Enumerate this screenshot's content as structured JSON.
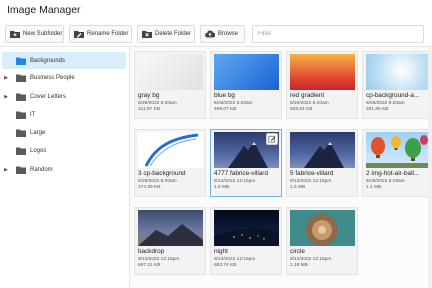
{
  "app": {
    "title": "Image Manager"
  },
  "toolbar": {
    "new_subfolder": "New Subfolder",
    "rename_folder": "Rename Folder",
    "delete_folder": "Delete Folder",
    "browse": "Browse",
    "filter_placeholder": "Filter"
  },
  "sidebar": {
    "items": [
      {
        "label": "Backgrounds",
        "expandable": false,
        "selected": true
      },
      {
        "label": "Business People",
        "expandable": true,
        "selected": false
      },
      {
        "label": "Cover Letters",
        "expandable": true,
        "selected": false
      },
      {
        "label": "IT",
        "expandable": false,
        "selected": false
      },
      {
        "label": "Large",
        "expandable": false,
        "selected": false
      },
      {
        "label": "Logos",
        "expandable": false,
        "selected": false
      },
      {
        "label": "Random",
        "expandable": true,
        "selected": false
      }
    ]
  },
  "images": [
    {
      "name": "gray bg",
      "date": "6/29/2022 8:20am",
      "size": "211.87 KB"
    },
    {
      "name": "blue bg",
      "date": "6/29/2022 8:20am",
      "size": "499.07 KB"
    },
    {
      "name": "red gradient",
      "date": "6/29/2022 8:20am",
      "size": "508.54 KB"
    },
    {
      "name": "cp-background-a...",
      "date": "6/29/2022 8:20am",
      "size": "281.85 KB"
    },
    {
      "name": "3 cp-background",
      "date": "6/29/2022 8:20am",
      "size": "174.39 KB"
    },
    {
      "name": "4777 fabrice-villard",
      "date": "9/13/2022 12:15pm",
      "size": "1.5 MB"
    },
    {
      "name": "5 fabrice-villard",
      "date": "9/13/2022 12:15pm",
      "size": "1.5 MB"
    },
    {
      "name": "2 img-hot-air-ball...",
      "date": "6/29/2022 8:19am",
      "size": "1.1 MB"
    },
    {
      "name": "backdrop",
      "date": "9/13/2022 12:15pm",
      "size": "697.21 KB"
    },
    {
      "name": "night",
      "date": "9/13/2022 12:15pm",
      "size": "883.74 KB"
    },
    {
      "name": "circle",
      "date": "9/13/2022 12:15pm",
      "size": "1.18 MB"
    }
  ],
  "colors": {
    "accent": "#1e88e5",
    "folder": "#5a5a5a",
    "selection_bg": "#d9eefb",
    "selection_border": "#6db3e3"
  }
}
